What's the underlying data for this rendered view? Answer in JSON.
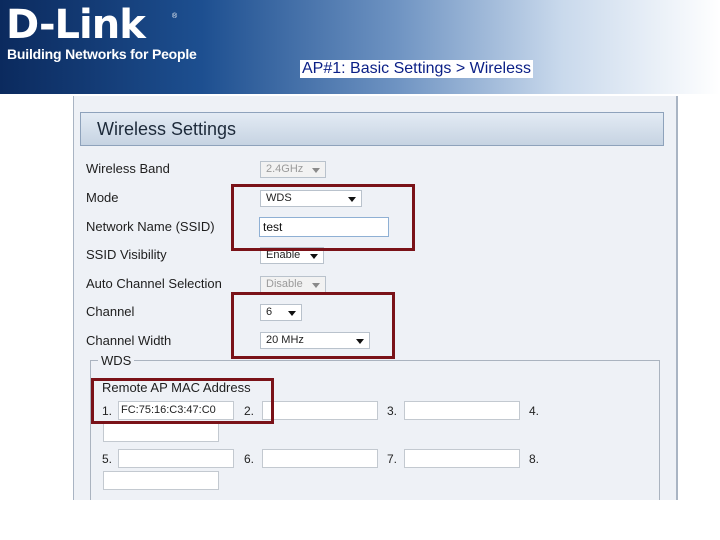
{
  "header": {
    "brand": "D-Link",
    "registered_mark": "®",
    "tagline": "Building Networks for People",
    "slide_title": "AP#1: Basic Settings > Wireless"
  },
  "panel": {
    "title": "Wireless Settings",
    "fields": {
      "wireless_band": {
        "label": "Wireless Band",
        "value": "2.4GHz"
      },
      "mode": {
        "label": "Mode",
        "value": "WDS"
      },
      "ssid": {
        "label": "Network Name (SSID)",
        "value": "test"
      },
      "ssid_visibility": {
        "label": "SSID Visibility",
        "value": "Enable"
      },
      "auto_channel": {
        "label": "Auto Channel Selection",
        "value": "Disable"
      },
      "channel": {
        "label": "Channel",
        "value": "6"
      },
      "channel_width": {
        "label": "Channel Width",
        "value": "20 MHz"
      }
    },
    "wds": {
      "legend": "WDS",
      "remote_mac_label": "Remote AP MAC Address",
      "entries": [
        {
          "num": "1.",
          "value": "FC:75:16:C3:47:C0"
        },
        {
          "num": "2.",
          "value": ""
        },
        {
          "num": "3.",
          "value": ""
        },
        {
          "num": "4.",
          "value": ""
        },
        {
          "num": "5.",
          "value": ""
        },
        {
          "num": "6.",
          "value": ""
        },
        {
          "num": "7.",
          "value": ""
        },
        {
          "num": "8.",
          "value": ""
        }
      ]
    }
  },
  "colors": {
    "highlight": "#7a1218",
    "slide_title": "#0a1f86",
    "header_dark": "#0b2a5e"
  }
}
